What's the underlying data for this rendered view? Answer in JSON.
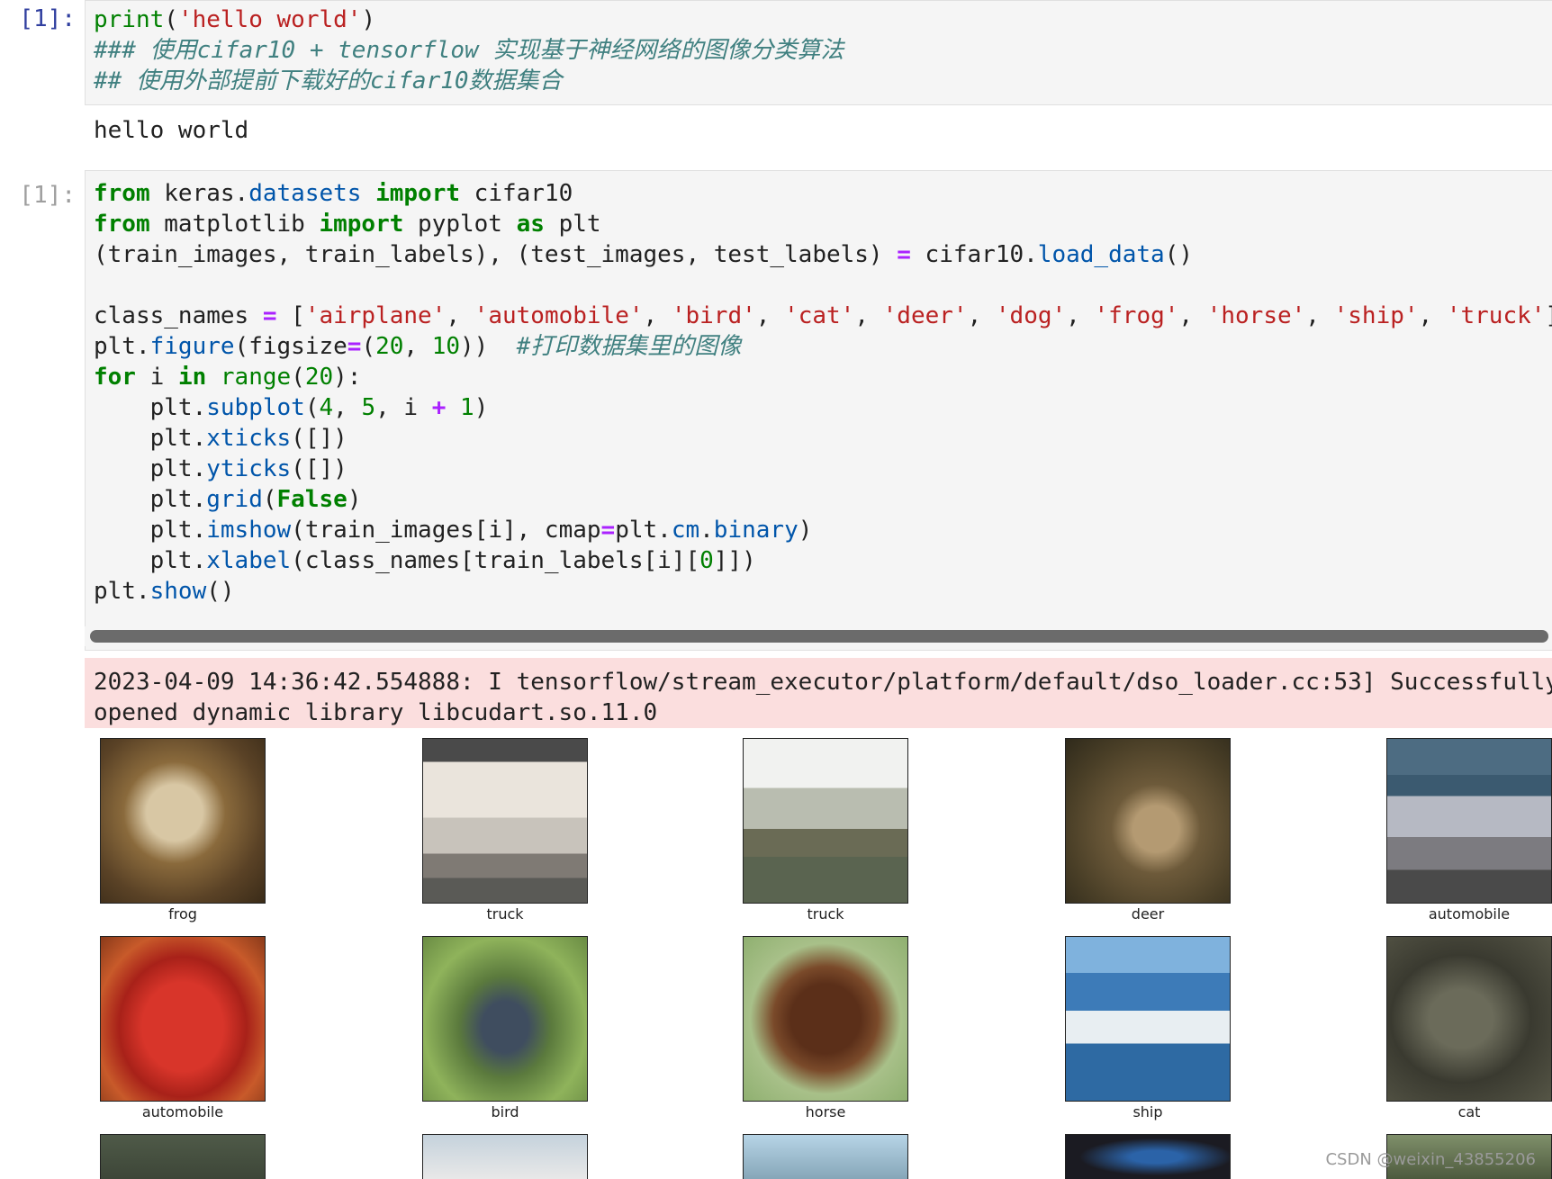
{
  "cell1": {
    "prompt": "[1]:",
    "code": {
      "l1_fn": "print",
      "l1_open": "(",
      "l1_str": "'hello world'",
      "l1_close": ")",
      "l2_comment": "### 使用cifar10 + tensorflow 实现基于神经网络的图像分类算法",
      "l3_comment": "## 使用外部提前下载好的cifar10数据集合"
    },
    "output": "hello world"
  },
  "cell2": {
    "prompt": "[1]:",
    "code": {
      "from": "from",
      "import": "import",
      "as": "as",
      "for": "for",
      "in": "in",
      "eq": "=",
      "plus": "+",
      "False": "False",
      "range": "range",
      "mod_keras": " keras.",
      "mod_datasets": "datasets",
      "sp": " ",
      "cifar10": " cifar10",
      "mod_matplotlib": " matplotlib ",
      "pyplot": " pyplot ",
      "plt": " plt",
      "l3_left": "(train_images, train_labels), (test_images, test_labels) ",
      "l3_right": " cifar10.",
      "load_data": "load_data",
      "parens": "()",
      "l5_left": "class_names ",
      "l5_bracket": " [",
      "s_airplane": "'airplane'",
      "s_automobile": "'automobile'",
      "s_bird": "'bird'",
      "s_cat": "'cat'",
      "s_deer": "'deer'",
      "s_dog": "'dog'",
      "s_frog": "'frog'",
      "s_horse": "'horse'",
      "s_ship": "'ship'",
      "s_truck": "'truck'",
      "comma": ", ",
      "rbracket": "]",
      "plt_dot": "plt.",
      "figure": "figure",
      "figsize": "(figsize",
      "paren_open": "(",
      "n20": "20",
      "n10": "10",
      "close2": "))  ",
      "comment_print": "#打印数据集里的图像",
      "for_i": " i ",
      "colon_end": "):",
      "indent": "    ",
      "subplot": "subplot",
      "n4": "4",
      "n5": "5",
      "i_mid": ", i ",
      "n1": "1",
      "close1": ")",
      "xticks": "xticks",
      "yticks": "yticks",
      "empty_list": "([])",
      "grid": "grid",
      "imshow": "imshow",
      "imshow_args": "(train_images[i], cmap",
      "plt_cm": "plt.",
      "cm": "cm",
      "dot": ".",
      "binary": "binary",
      "xlabel": "xlabel",
      "xlabel_args": "(class_names[train_labels[i][",
      "n0": "0",
      "close3": "]])",
      "show": "show"
    }
  },
  "stderr": {
    "line1": "2023-04-09 14:36:42.554888: I tensorflow/stream_executor/platform/default/dso_loader.cc:53] Successfully",
    "line2": "opened dynamic library libcudart.so.11.0"
  },
  "images": [
    {
      "label": "frog"
    },
    {
      "label": "truck"
    },
    {
      "label": "truck"
    },
    {
      "label": "deer"
    },
    {
      "label": "automobile"
    },
    {
      "label": "automobile"
    },
    {
      "label": "bird"
    },
    {
      "label": "horse"
    },
    {
      "label": "ship"
    },
    {
      "label": "cat"
    }
  ],
  "watermark": "CSDN @weixin_43855206"
}
